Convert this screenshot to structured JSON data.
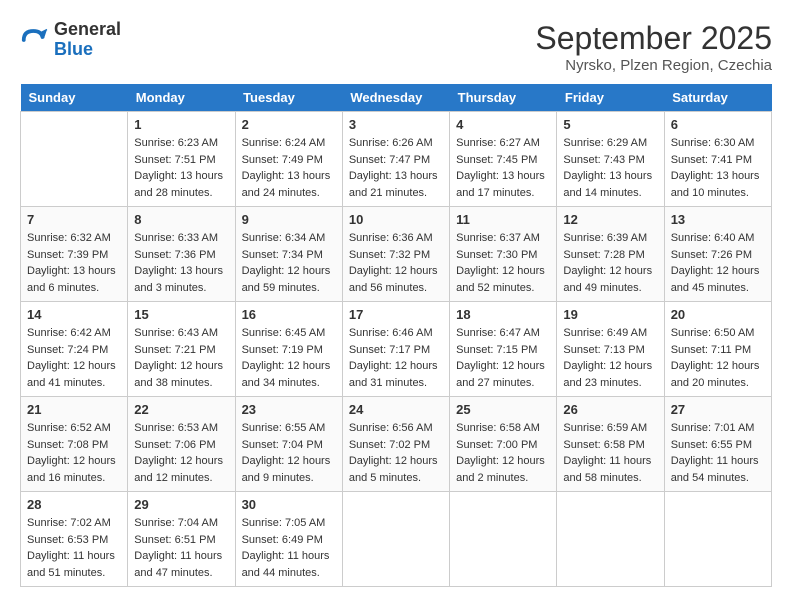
{
  "header": {
    "logo_line1": "General",
    "logo_line2": "Blue",
    "month": "September 2025",
    "location": "Nyrsko, Plzen Region, Czechia"
  },
  "days_of_week": [
    "Sunday",
    "Monday",
    "Tuesday",
    "Wednesday",
    "Thursday",
    "Friday",
    "Saturday"
  ],
  "weeks": [
    [
      {
        "num": "",
        "info": ""
      },
      {
        "num": "1",
        "info": "Sunrise: 6:23 AM\nSunset: 7:51 PM\nDaylight: 13 hours\nand 28 minutes."
      },
      {
        "num": "2",
        "info": "Sunrise: 6:24 AM\nSunset: 7:49 PM\nDaylight: 13 hours\nand 24 minutes."
      },
      {
        "num": "3",
        "info": "Sunrise: 6:26 AM\nSunset: 7:47 PM\nDaylight: 13 hours\nand 21 minutes."
      },
      {
        "num": "4",
        "info": "Sunrise: 6:27 AM\nSunset: 7:45 PM\nDaylight: 13 hours\nand 17 minutes."
      },
      {
        "num": "5",
        "info": "Sunrise: 6:29 AM\nSunset: 7:43 PM\nDaylight: 13 hours\nand 14 minutes."
      },
      {
        "num": "6",
        "info": "Sunrise: 6:30 AM\nSunset: 7:41 PM\nDaylight: 13 hours\nand 10 minutes."
      }
    ],
    [
      {
        "num": "7",
        "info": "Sunrise: 6:32 AM\nSunset: 7:39 PM\nDaylight: 13 hours\nand 6 minutes."
      },
      {
        "num": "8",
        "info": "Sunrise: 6:33 AM\nSunset: 7:36 PM\nDaylight: 13 hours\nand 3 minutes."
      },
      {
        "num": "9",
        "info": "Sunrise: 6:34 AM\nSunset: 7:34 PM\nDaylight: 12 hours\nand 59 minutes."
      },
      {
        "num": "10",
        "info": "Sunrise: 6:36 AM\nSunset: 7:32 PM\nDaylight: 12 hours\nand 56 minutes."
      },
      {
        "num": "11",
        "info": "Sunrise: 6:37 AM\nSunset: 7:30 PM\nDaylight: 12 hours\nand 52 minutes."
      },
      {
        "num": "12",
        "info": "Sunrise: 6:39 AM\nSunset: 7:28 PM\nDaylight: 12 hours\nand 49 minutes."
      },
      {
        "num": "13",
        "info": "Sunrise: 6:40 AM\nSunset: 7:26 PM\nDaylight: 12 hours\nand 45 minutes."
      }
    ],
    [
      {
        "num": "14",
        "info": "Sunrise: 6:42 AM\nSunset: 7:24 PM\nDaylight: 12 hours\nand 41 minutes."
      },
      {
        "num": "15",
        "info": "Sunrise: 6:43 AM\nSunset: 7:21 PM\nDaylight: 12 hours\nand 38 minutes."
      },
      {
        "num": "16",
        "info": "Sunrise: 6:45 AM\nSunset: 7:19 PM\nDaylight: 12 hours\nand 34 minutes."
      },
      {
        "num": "17",
        "info": "Sunrise: 6:46 AM\nSunset: 7:17 PM\nDaylight: 12 hours\nand 31 minutes."
      },
      {
        "num": "18",
        "info": "Sunrise: 6:47 AM\nSunset: 7:15 PM\nDaylight: 12 hours\nand 27 minutes."
      },
      {
        "num": "19",
        "info": "Sunrise: 6:49 AM\nSunset: 7:13 PM\nDaylight: 12 hours\nand 23 minutes."
      },
      {
        "num": "20",
        "info": "Sunrise: 6:50 AM\nSunset: 7:11 PM\nDaylight: 12 hours\nand 20 minutes."
      }
    ],
    [
      {
        "num": "21",
        "info": "Sunrise: 6:52 AM\nSunset: 7:08 PM\nDaylight: 12 hours\nand 16 minutes."
      },
      {
        "num": "22",
        "info": "Sunrise: 6:53 AM\nSunset: 7:06 PM\nDaylight: 12 hours\nand 12 minutes."
      },
      {
        "num": "23",
        "info": "Sunrise: 6:55 AM\nSunset: 7:04 PM\nDaylight: 12 hours\nand 9 minutes."
      },
      {
        "num": "24",
        "info": "Sunrise: 6:56 AM\nSunset: 7:02 PM\nDaylight: 12 hours\nand 5 minutes."
      },
      {
        "num": "25",
        "info": "Sunrise: 6:58 AM\nSunset: 7:00 PM\nDaylight: 12 hours\nand 2 minutes."
      },
      {
        "num": "26",
        "info": "Sunrise: 6:59 AM\nSunset: 6:58 PM\nDaylight: 11 hours\nand 58 minutes."
      },
      {
        "num": "27",
        "info": "Sunrise: 7:01 AM\nSunset: 6:55 PM\nDaylight: 11 hours\nand 54 minutes."
      }
    ],
    [
      {
        "num": "28",
        "info": "Sunrise: 7:02 AM\nSunset: 6:53 PM\nDaylight: 11 hours\nand 51 minutes."
      },
      {
        "num": "29",
        "info": "Sunrise: 7:04 AM\nSunset: 6:51 PM\nDaylight: 11 hours\nand 47 minutes."
      },
      {
        "num": "30",
        "info": "Sunrise: 7:05 AM\nSunset: 6:49 PM\nDaylight: 11 hours\nand 44 minutes."
      },
      {
        "num": "",
        "info": ""
      },
      {
        "num": "",
        "info": ""
      },
      {
        "num": "",
        "info": ""
      },
      {
        "num": "",
        "info": ""
      }
    ]
  ]
}
